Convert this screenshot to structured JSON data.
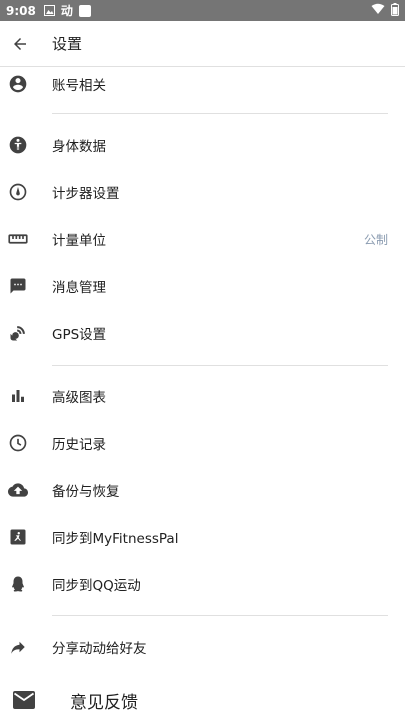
{
  "status_bar": {
    "time": "9:08",
    "app_glyph": "动"
  },
  "app_bar": {
    "title": "设置"
  },
  "items": [
    {
      "label": "账号相关",
      "icon": "account-icon"
    },
    {
      "label": "身体数据",
      "icon": "body-icon"
    },
    {
      "label": "计步器设置",
      "icon": "pedometer-icon"
    },
    {
      "label": "计量单位",
      "icon": "ruler-icon",
      "value": "公制"
    },
    {
      "label": "消息管理",
      "icon": "message-icon"
    },
    {
      "label": "GPS设置",
      "icon": "gps-icon"
    },
    {
      "label": "高级图表",
      "icon": "chart-icon"
    },
    {
      "label": "历史记录",
      "icon": "history-icon"
    },
    {
      "label": "备份与恢复",
      "icon": "cloud-upload-icon"
    },
    {
      "label": "同步到MyFitnessPal",
      "icon": "myfitnesspal-icon"
    },
    {
      "label": "同步到QQ运动",
      "icon": "qq-icon"
    },
    {
      "label": "分享动动给好友",
      "icon": "share-icon"
    }
  ],
  "feedback": {
    "label": "意见反馈",
    "icon": "mail-icon"
  },
  "colors": {
    "status_bar": "#757575",
    "icon": "#424242",
    "value_text": "#8a9bb0",
    "divider": "#e0e0e0"
  }
}
